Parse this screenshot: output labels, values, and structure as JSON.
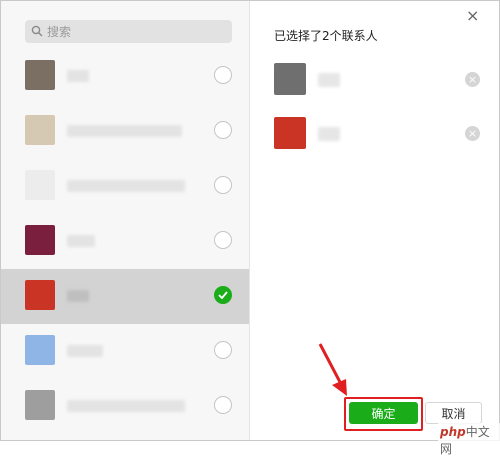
{
  "search": {
    "placeholder": "搜索"
  },
  "contacts": [
    {
      "avatar_color": "#7b6f63",
      "name_width": 22,
      "selected": false
    },
    {
      "avatar_color": "#d6c9b3",
      "name_width": 115,
      "selected": false
    },
    {
      "avatar_color": "#ececec",
      "name_width": 118,
      "selected": false
    },
    {
      "avatar_color": "#7a1f3d",
      "name_width": 28,
      "selected": false
    },
    {
      "avatar_color": "#c93424",
      "name_width": 22,
      "selected": true
    },
    {
      "avatar_color": "#8fb4e6",
      "name_width": 36,
      "selected": false
    },
    {
      "avatar_color": "#9e9e9e",
      "name_width": 118,
      "selected": false
    }
  ],
  "selection": {
    "title": "已选择了2个联系人",
    "items": [
      {
        "avatar_color": "#6f6f6f",
        "name_width": 22
      },
      {
        "avatar_color": "#c93424",
        "name_width": 22
      }
    ]
  },
  "buttons": {
    "ok": "确定",
    "cancel": "取消"
  },
  "window": {
    "close": "×"
  },
  "watermark": {
    "brand": "php",
    "text": "中文网"
  },
  "colors": {
    "accent": "#1aad19",
    "highlight": "#e02020"
  }
}
